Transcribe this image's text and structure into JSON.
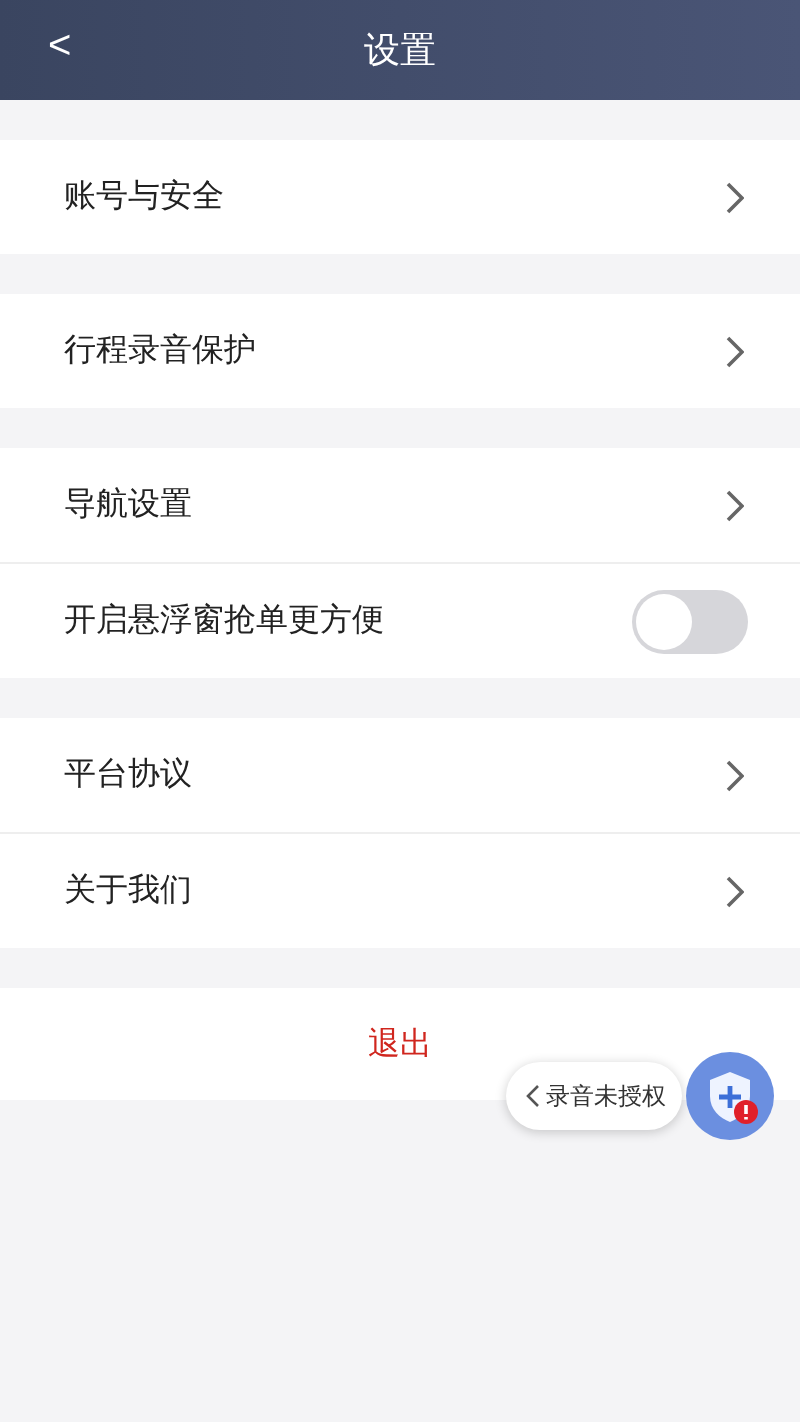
{
  "header": {
    "back": "<",
    "title": "设置"
  },
  "groups": [
    {
      "items": [
        {
          "kind": "link",
          "label": "账号与安全"
        }
      ]
    },
    {
      "items": [
        {
          "kind": "link",
          "label": "行程录音保护"
        }
      ]
    },
    {
      "items": [
        {
          "kind": "link",
          "label": "导航设置"
        },
        {
          "kind": "toggle",
          "label": "开启悬浮窗抢单更方便",
          "on": false
        }
      ]
    },
    {
      "items": [
        {
          "kind": "link",
          "label": "平台协议"
        },
        {
          "kind": "link",
          "label": "关于我们"
        }
      ]
    }
  ],
  "logout": "退出",
  "floating_badge": {
    "text": "录音未授权",
    "alert": true
  }
}
